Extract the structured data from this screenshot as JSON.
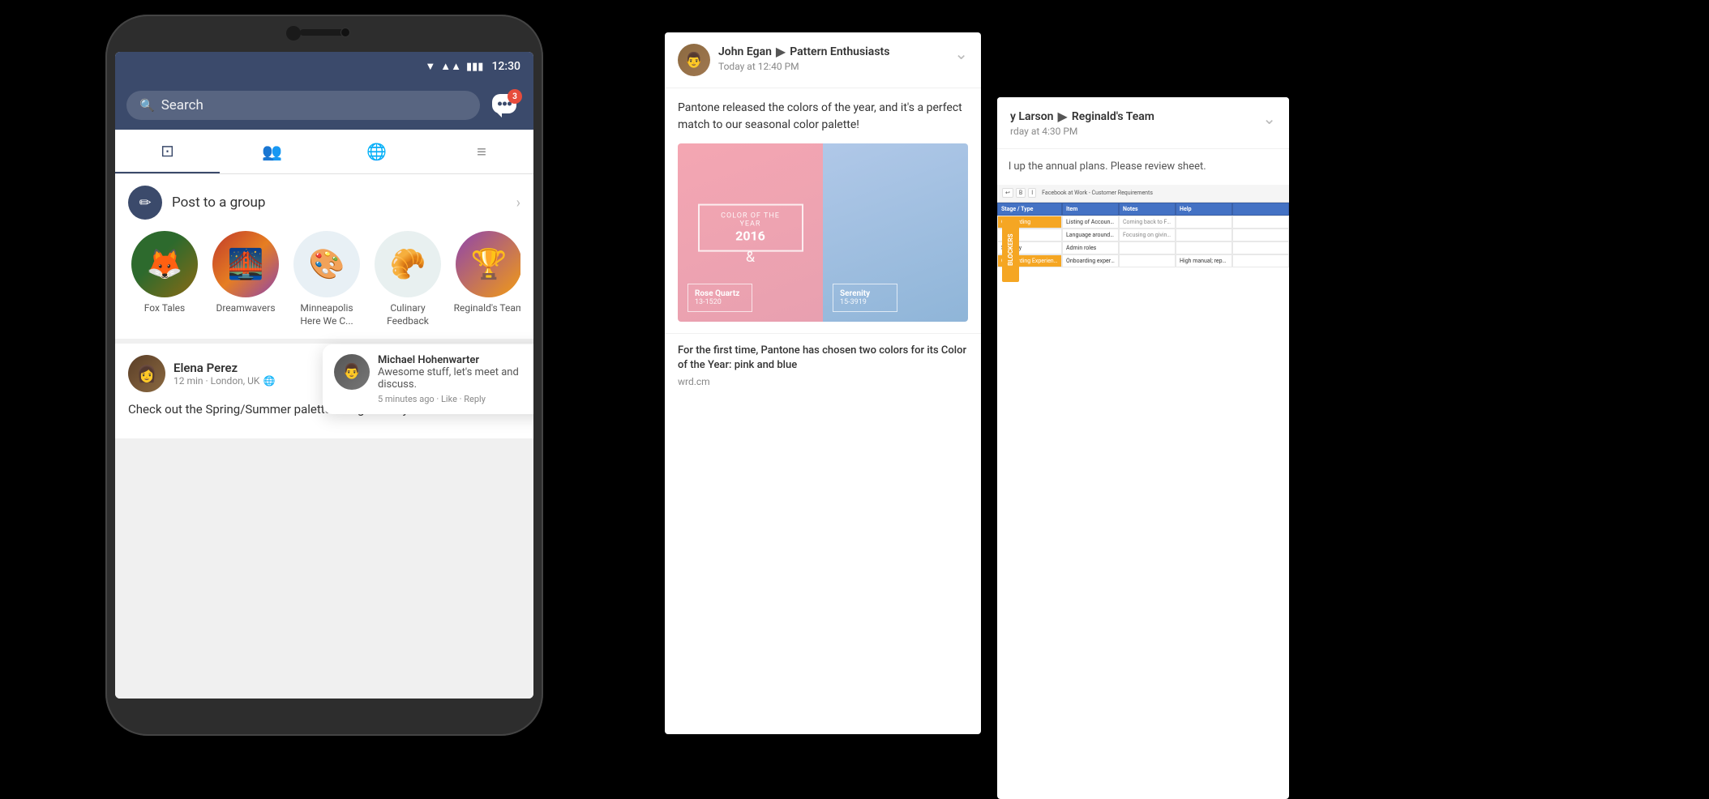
{
  "phone": {
    "status": {
      "time": "12:30",
      "wifi": "▼",
      "signal": "▲",
      "battery": "🔋"
    },
    "search": {
      "placeholder": "Search",
      "notification_count": "3"
    },
    "nav_tabs": [
      {
        "id": "home",
        "icon": "⊞",
        "active": true
      },
      {
        "id": "groups",
        "icon": "👥",
        "active": false
      },
      {
        "id": "globe",
        "icon": "🌐",
        "active": false
      },
      {
        "id": "menu",
        "icon": "≡",
        "active": false
      }
    ],
    "post_to_group": {
      "label": "Post to a group"
    },
    "groups": [
      {
        "name": "Fox Tales",
        "type": "fox"
      },
      {
        "name": "Dreamwavers",
        "type": "dreamwavers"
      },
      {
        "name": "Minneapolis Here We C...",
        "type": "minneapolis"
      },
      {
        "name": "Culinary Feedback",
        "type": "culinary"
      },
      {
        "name": "Reginald's Team",
        "type": "reginald"
      }
    ],
    "post": {
      "author": "Elena Perez",
      "meta": "12 min · London, UK",
      "body": "Check out the Spring/Summer palette and give me your feedback!"
    },
    "comment": {
      "author": "Michael Hohenwarter",
      "text": "Awesome stuff, let's meet and discuss.",
      "time": "5 minutes ago",
      "actions": "Like · Reply"
    }
  },
  "main_card": {
    "author": "John Egan",
    "group": "Pattern Enthusiasts",
    "time": "Today at 12:40 PM",
    "text": "Pantone released the colors of the year, and it's a perfect match to our seasonal color palette!",
    "pantone": {
      "year_label": "Color of the Year",
      "year": "2016",
      "color1_name": "Rose Quartz",
      "color1_code": "13-1520",
      "color2_name": "Serenity",
      "color2_code": "15-3919"
    },
    "link_title": "For the first time, Pantone has chosen two colors for its Color of the Year: pink and blue",
    "link_url": "wrd.cm"
  },
  "second_card": {
    "author": "y Larson",
    "group": "Reginald's Team",
    "time": "rday at 4:30 PM",
    "text": "l up the annual plans. Please review sheet.",
    "spreadsheet": {
      "title": "Facebook at Work - Customer Requirements",
      "headers": [
        "Stage / Type",
        "Item",
        "Notes",
        "Help"
      ],
      "rows": [
        [
          "Onboarding",
          "Listing of Accounts - Claim and Login",
          "Coming back to Facebook at Work...",
          ""
        ],
        [
          "",
          "Language around the Claiming...",
          "",
          ""
        ],
        [
          "Security",
          "Admin roles",
          "",
          ""
        ],
        [
          "Onboarding Experience",
          "",
          "",
          ""
        ]
      ],
      "blockers_label": "BLOCKERS"
    }
  }
}
